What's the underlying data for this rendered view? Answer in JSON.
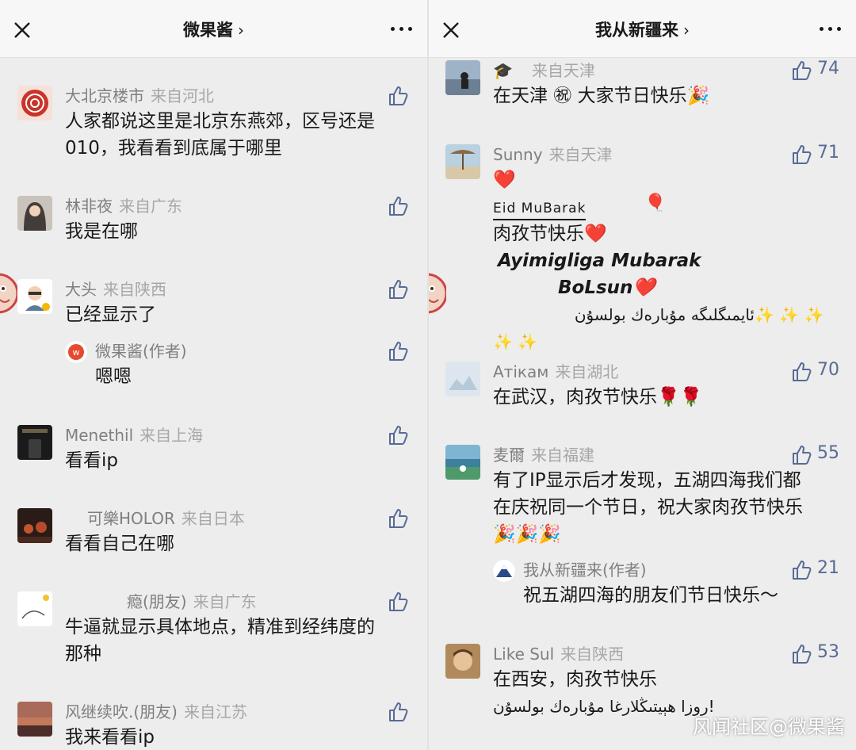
{
  "left": {
    "title": "微果酱",
    "chevron": "›",
    "comments": [
      {
        "name": "大北京楼市",
        "from": "来自河北",
        "text_lines": [
          "人家都说这里是北京东燕郊，区号还是",
          "010，我看看到底属于哪里"
        ]
      },
      {
        "name": "林非夜",
        "from": "来自广东",
        "text_lines": [
          "我是在哪"
        ]
      },
      {
        "name": "大头",
        "from": "来自陕西",
        "text_lines": [
          "已经显示了"
        ]
      },
      {
        "name": "Menethil",
        "from": "来自上海",
        "text_lines": [
          "看看ip"
        ]
      },
      {
        "name": "可樂HOLOR",
        "from": "来自日本",
        "text_lines": [
          "看看自己在哪"
        ]
      },
      {
        "name": "瘾(朋友)",
        "from": "来自广东",
        "text_lines": [
          "牛逼就显示具体地点，精准到经纬度的",
          "那种"
        ]
      },
      {
        "name": "风继续吹.(朋友)",
        "from": "来自江苏",
        "text_lines": [
          "我来看看ip"
        ]
      }
    ],
    "reply": {
      "name": "微果酱(作者)",
      "text": "嗯嗯"
    }
  },
  "right": {
    "title": "我从新疆来",
    "chevron": "›",
    "comments": [
      {
        "name": "🎓",
        "from": "来自天津",
        "likes": "74",
        "text_lines": [
          "在天津 ㊗ 大家节日快乐🎉"
        ]
      },
      {
        "name": "Sunny",
        "from": "来自天津",
        "likes": "71",
        "lines": [
          "❤️",
          "Eid MuBarak",
          "肉孜节快乐❤️",
          "Ayimigliga Mubarak",
          "BoLsun❤️",
          "ئايمىگلىگە مۇبارەك بولسۇن",
          "✨ ✨ ✨ ✨ ✨",
          "🎈"
        ]
      },
      {
        "name": "Атікам",
        "from": "来自湖北",
        "likes": "70",
        "text_lines": [
          "在武汉，肉孜节快乐🌹🌹"
        ]
      },
      {
        "name": "麦爾",
        "from": "来自福建",
        "likes": "55",
        "text_lines": [
          "有了IP显示后才发现，五湖四海我们都",
          "在庆祝同一个节日，祝大家肉孜节快乐",
          "🎉🎉🎉"
        ]
      },
      {
        "name": "Like Sul",
        "from": "来自陕西",
        "likes": "53",
        "text_lines": [
          "在西安，肉孜节快乐",
          "!روزا ھېيتىڭلارغا مۇبارەك بولسۇن"
        ]
      }
    ],
    "reply": {
      "name": "我从新疆来(作者)",
      "likes": "21",
      "text": "祝五湖四海的朋友们节日快乐～"
    }
  },
  "watermark": "风闻社区@微果酱",
  "colors": {
    "background": "#ededed",
    "header": "#f7f7f7",
    "link_blue": "#576b95",
    "name_gray": "#7f7f7f",
    "from_gray": "#a7a7a7"
  }
}
